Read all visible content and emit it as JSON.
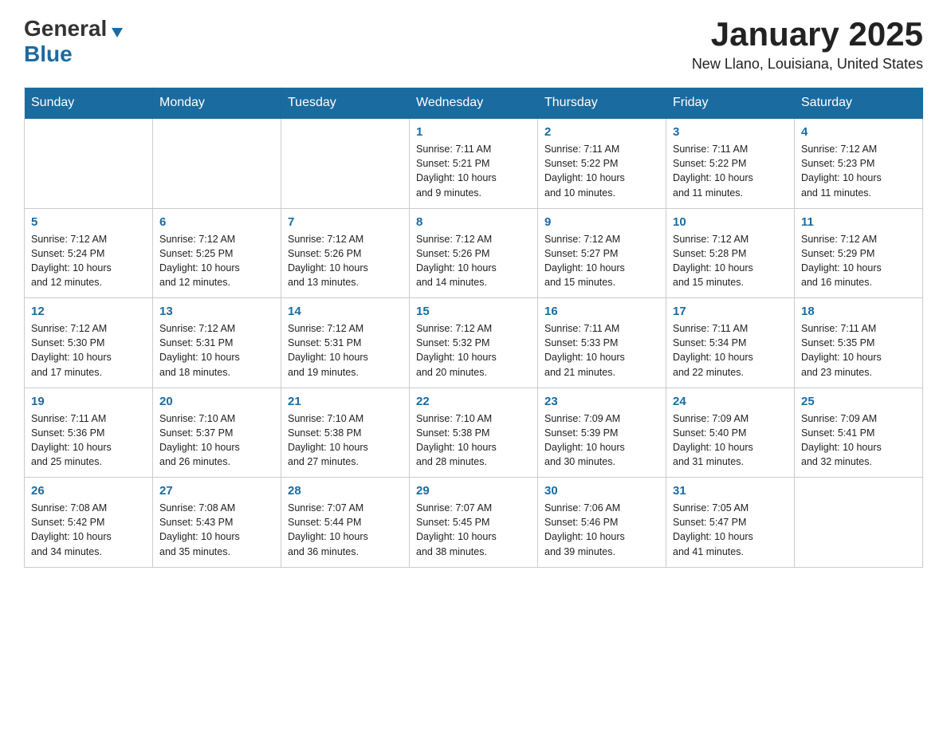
{
  "header": {
    "logo_general": "General",
    "logo_blue": "Blue",
    "month_title": "January 2025",
    "location": "New Llano, Louisiana, United States"
  },
  "calendar": {
    "days_of_week": [
      "Sunday",
      "Monday",
      "Tuesday",
      "Wednesday",
      "Thursday",
      "Friday",
      "Saturday"
    ],
    "weeks": [
      [
        {
          "day": "",
          "info": ""
        },
        {
          "day": "",
          "info": ""
        },
        {
          "day": "",
          "info": ""
        },
        {
          "day": "1",
          "info": "Sunrise: 7:11 AM\nSunset: 5:21 PM\nDaylight: 10 hours\nand 9 minutes."
        },
        {
          "day": "2",
          "info": "Sunrise: 7:11 AM\nSunset: 5:22 PM\nDaylight: 10 hours\nand 10 minutes."
        },
        {
          "day": "3",
          "info": "Sunrise: 7:11 AM\nSunset: 5:22 PM\nDaylight: 10 hours\nand 11 minutes."
        },
        {
          "day": "4",
          "info": "Sunrise: 7:12 AM\nSunset: 5:23 PM\nDaylight: 10 hours\nand 11 minutes."
        }
      ],
      [
        {
          "day": "5",
          "info": "Sunrise: 7:12 AM\nSunset: 5:24 PM\nDaylight: 10 hours\nand 12 minutes."
        },
        {
          "day": "6",
          "info": "Sunrise: 7:12 AM\nSunset: 5:25 PM\nDaylight: 10 hours\nand 12 minutes."
        },
        {
          "day": "7",
          "info": "Sunrise: 7:12 AM\nSunset: 5:26 PM\nDaylight: 10 hours\nand 13 minutes."
        },
        {
          "day": "8",
          "info": "Sunrise: 7:12 AM\nSunset: 5:26 PM\nDaylight: 10 hours\nand 14 minutes."
        },
        {
          "day": "9",
          "info": "Sunrise: 7:12 AM\nSunset: 5:27 PM\nDaylight: 10 hours\nand 15 minutes."
        },
        {
          "day": "10",
          "info": "Sunrise: 7:12 AM\nSunset: 5:28 PM\nDaylight: 10 hours\nand 15 minutes."
        },
        {
          "day": "11",
          "info": "Sunrise: 7:12 AM\nSunset: 5:29 PM\nDaylight: 10 hours\nand 16 minutes."
        }
      ],
      [
        {
          "day": "12",
          "info": "Sunrise: 7:12 AM\nSunset: 5:30 PM\nDaylight: 10 hours\nand 17 minutes."
        },
        {
          "day": "13",
          "info": "Sunrise: 7:12 AM\nSunset: 5:31 PM\nDaylight: 10 hours\nand 18 minutes."
        },
        {
          "day": "14",
          "info": "Sunrise: 7:12 AM\nSunset: 5:31 PM\nDaylight: 10 hours\nand 19 minutes."
        },
        {
          "day": "15",
          "info": "Sunrise: 7:12 AM\nSunset: 5:32 PM\nDaylight: 10 hours\nand 20 minutes."
        },
        {
          "day": "16",
          "info": "Sunrise: 7:11 AM\nSunset: 5:33 PM\nDaylight: 10 hours\nand 21 minutes."
        },
        {
          "day": "17",
          "info": "Sunrise: 7:11 AM\nSunset: 5:34 PM\nDaylight: 10 hours\nand 22 minutes."
        },
        {
          "day": "18",
          "info": "Sunrise: 7:11 AM\nSunset: 5:35 PM\nDaylight: 10 hours\nand 23 minutes."
        }
      ],
      [
        {
          "day": "19",
          "info": "Sunrise: 7:11 AM\nSunset: 5:36 PM\nDaylight: 10 hours\nand 25 minutes."
        },
        {
          "day": "20",
          "info": "Sunrise: 7:10 AM\nSunset: 5:37 PM\nDaylight: 10 hours\nand 26 minutes."
        },
        {
          "day": "21",
          "info": "Sunrise: 7:10 AM\nSunset: 5:38 PM\nDaylight: 10 hours\nand 27 minutes."
        },
        {
          "day": "22",
          "info": "Sunrise: 7:10 AM\nSunset: 5:38 PM\nDaylight: 10 hours\nand 28 minutes."
        },
        {
          "day": "23",
          "info": "Sunrise: 7:09 AM\nSunset: 5:39 PM\nDaylight: 10 hours\nand 30 minutes."
        },
        {
          "day": "24",
          "info": "Sunrise: 7:09 AM\nSunset: 5:40 PM\nDaylight: 10 hours\nand 31 minutes."
        },
        {
          "day": "25",
          "info": "Sunrise: 7:09 AM\nSunset: 5:41 PM\nDaylight: 10 hours\nand 32 minutes."
        }
      ],
      [
        {
          "day": "26",
          "info": "Sunrise: 7:08 AM\nSunset: 5:42 PM\nDaylight: 10 hours\nand 34 minutes."
        },
        {
          "day": "27",
          "info": "Sunrise: 7:08 AM\nSunset: 5:43 PM\nDaylight: 10 hours\nand 35 minutes."
        },
        {
          "day": "28",
          "info": "Sunrise: 7:07 AM\nSunset: 5:44 PM\nDaylight: 10 hours\nand 36 minutes."
        },
        {
          "day": "29",
          "info": "Sunrise: 7:07 AM\nSunset: 5:45 PM\nDaylight: 10 hours\nand 38 minutes."
        },
        {
          "day": "30",
          "info": "Sunrise: 7:06 AM\nSunset: 5:46 PM\nDaylight: 10 hours\nand 39 minutes."
        },
        {
          "day": "31",
          "info": "Sunrise: 7:05 AM\nSunset: 5:47 PM\nDaylight: 10 hours\nand 41 minutes."
        },
        {
          "day": "",
          "info": ""
        }
      ]
    ]
  }
}
